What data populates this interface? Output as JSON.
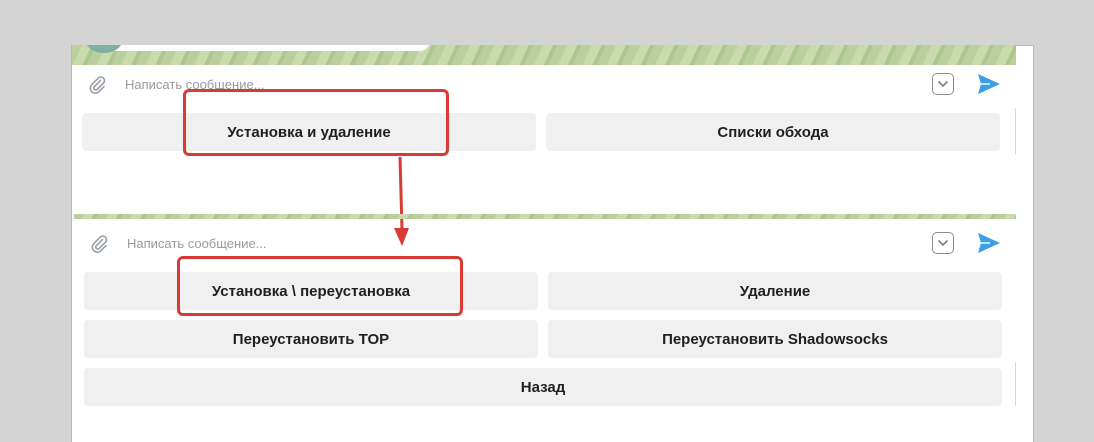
{
  "top_panel": {
    "placeholder": "Написать сообщение...",
    "buttons": [
      "Установка и удаление",
      "Списки обхода"
    ]
  },
  "bottom_panel": {
    "placeholder": "Написать сообщение...",
    "buttons": [
      "Установка \\ переустановка",
      "Удаление",
      "Переустановить TOP",
      "Переустановить Shadowsocks",
      "Назад"
    ]
  },
  "colors": {
    "accent_send": "#3a9ee8",
    "highlight": "#d93a34",
    "button_bg": "#f0f0f0"
  },
  "icons": [
    "paperclip-icon",
    "sticker-icon",
    "send-icon",
    "arrow-down-icon"
  ]
}
